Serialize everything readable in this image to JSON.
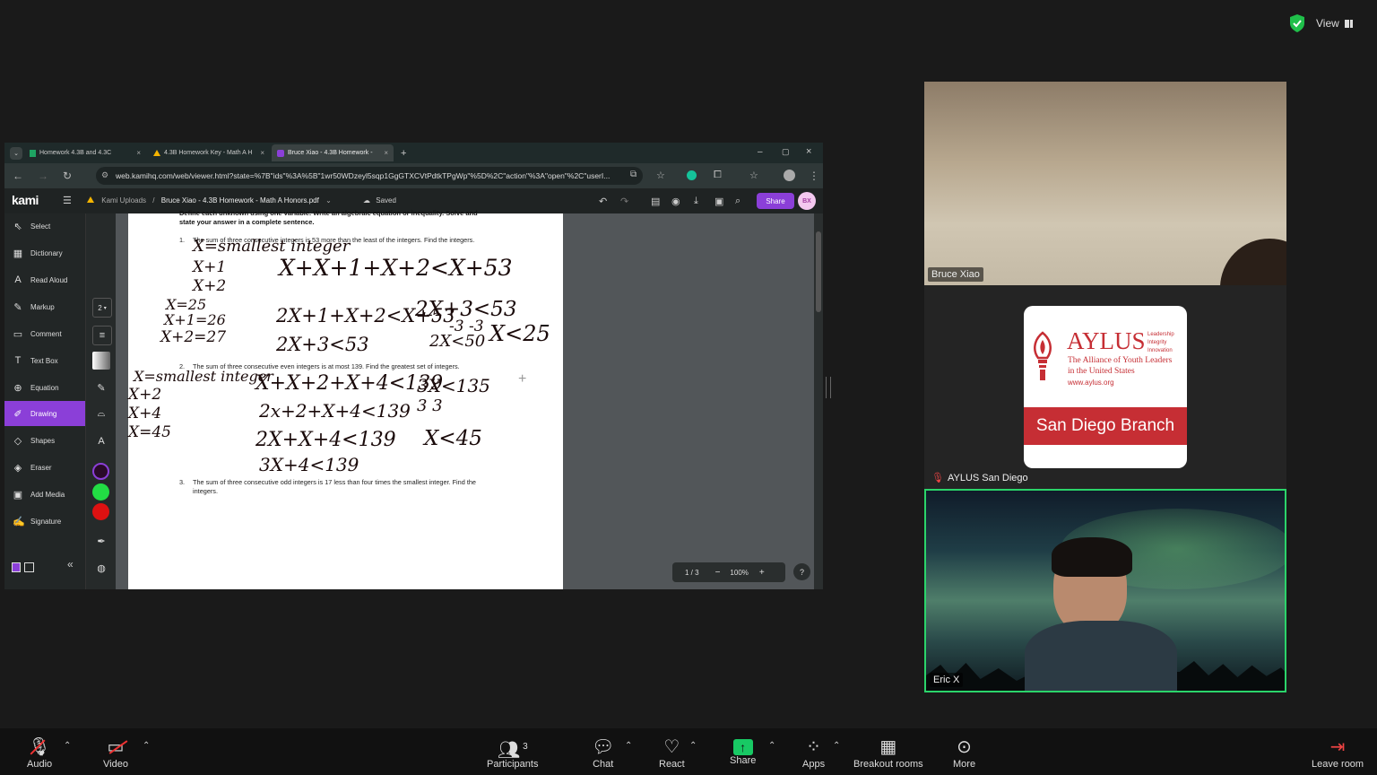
{
  "topbar": {
    "view_label": "View"
  },
  "browser": {
    "tabs": [
      {
        "label": "Homework 4.3B and 4.3C",
        "close": "×"
      },
      {
        "label": "4.3B Homework Key - Math A H",
        "close": "×"
      },
      {
        "label": "Bruce Xiao - 4.3B Homework - ",
        "close": "×"
      }
    ],
    "new_tab": "+",
    "url": "web.kamihq.com/web/viewer.html?state=%7B\"ids\"%3A%5B\"1wr50WDzeyl5sqp1GgGTXCVtPdtkTPgWp\"%5D%2C\"action\"%3A\"open\"%2C\"userI..."
  },
  "kami": {
    "logo": "kami",
    "breadcrumb_root": "Kami Uploads",
    "breadcrumb_sep": "/",
    "file_name": "Bruce Xiao - 4.3B Homework - Math A Honors.pdf",
    "saved": "Saved",
    "share_label": "Share",
    "avatar_initials": "BX",
    "sidebar": [
      {
        "label": "Select",
        "icon": "cursor-icon"
      },
      {
        "label": "Dictionary",
        "icon": "dictionary-icon"
      },
      {
        "label": "Read Aloud",
        "icon": "read-aloud-icon"
      },
      {
        "label": "Markup",
        "icon": "markup-icon"
      },
      {
        "label": "Comment",
        "icon": "comment-icon"
      },
      {
        "label": "Text Box",
        "icon": "text-box-icon"
      },
      {
        "label": "Equation",
        "icon": "equation-icon"
      },
      {
        "label": "Drawing",
        "icon": "drawing-icon"
      },
      {
        "label": "Shapes",
        "icon": "shapes-icon"
      },
      {
        "label": "Eraser",
        "icon": "eraser-icon"
      },
      {
        "label": "Add Media",
        "icon": "add-media-icon"
      },
      {
        "label": "Signature",
        "icon": "signature-icon"
      }
    ],
    "stroke_size": "2",
    "colors": {
      "purple": "#8b3fd8",
      "swatch_dark": "#2a0a2a",
      "swatch_green": "#22dd44",
      "swatch_red": "#dd1111"
    },
    "page_indicator": "1 / 3",
    "zoom": "100%",
    "help": "?"
  },
  "document": {
    "header_line1": "Define each unknown using one variable.  Write an algebraic equation or inequality.  Solve and",
    "header_line2": "state your answer in a complete sentence.",
    "q1_num": "1.",
    "q1": "The sum of three consecutive integers is 53 more than the least of the integers.  Find the integers.",
    "q2_num": "2.",
    "q2": "The sum of three consecutive even integers is at most 139.  Find the greatest set of integers.",
    "q3_num": "3.",
    "q3_line1": "The sum of three consecutive odd integers is 17 less than four times the smallest integer.  Find the",
    "q3_line2": "integers.",
    "handwriting": {
      "h1": "X=smallest integer",
      "h2": "X+1",
      "h3": "X+2",
      "h4": "X+X+1+X+2<X+53",
      "h5": "X=25",
      "h6": "X+1=26",
      "h7": "X+2=27",
      "h8": "2X+1+X+2<X+53",
      "h9": "2X+3<53",
      "h10": "-3   -3",
      "h11": "2X+3<53",
      "h12": "2X<50",
      "h13": "X<25",
      "h14": "X=smallest integer",
      "h15": "X+2",
      "h16": "X+4",
      "h17": "X=45",
      "h18": "X+X+2+X+4<139",
      "h19": "2x+2+X+4<139",
      "h20": "3X<135",
      "h21": "3      3",
      "h22": "2X+X+4<139",
      "h23": "X<45",
      "h24": "3X+4<139"
    }
  },
  "participants": [
    {
      "name": "Bruce Xiao"
    },
    {
      "name": "AYLUS San Diego"
    },
    {
      "name": "Eric X"
    }
  ],
  "aylus_logo": {
    "title": "AYLUS",
    "tag1": "Leadership",
    "tag2": "Integrity",
    "tag3": "Innovation",
    "line1": "The Alliance of Youth Leaders",
    "line2": "in the United States",
    "url": "www.aylus.org",
    "branch": "San Diego Branch"
  },
  "zoom_bar": {
    "audio": "Audio",
    "video": "Video",
    "participants": "Participants",
    "participants_count": "3",
    "chat": "Chat",
    "react": "React",
    "share": "Share",
    "apps": "Apps",
    "breakout": "Breakout rooms",
    "more": "More",
    "leave": "Leave room"
  }
}
